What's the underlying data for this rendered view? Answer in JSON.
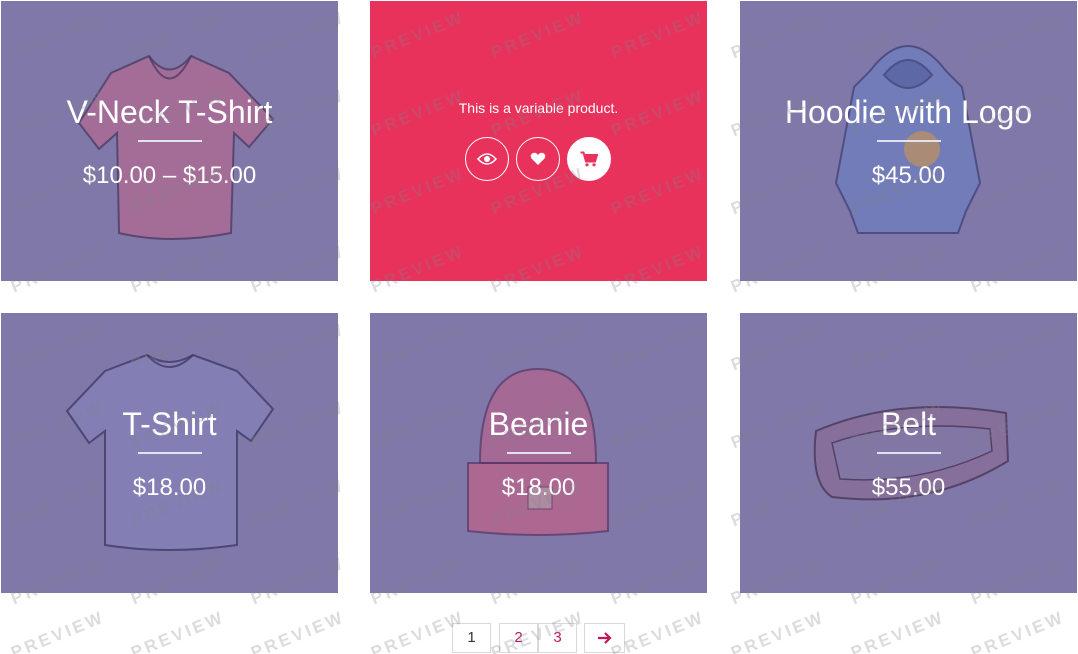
{
  "products": [
    {
      "title": "V-Neck T-Shirt",
      "price": "$10.00 – $15.00"
    },
    {
      "description": "This is a variable product."
    },
    {
      "title": "Hoodie with Logo",
      "price": "$45.00"
    },
    {
      "title": "T-Shirt",
      "price": "$18.00"
    },
    {
      "title": "Beanie",
      "price": "$18.00"
    },
    {
      "title": "Belt",
      "price": "$55.00"
    }
  ],
  "actions": {
    "quick_view_icon": "eye-icon",
    "wishlist_icon": "heart-icon",
    "cart_icon": "cart-icon"
  },
  "pagination": {
    "pages": [
      "1",
      "2",
      "3"
    ],
    "current": "1",
    "next_icon": "arrow-right-icon"
  },
  "watermark": "PREVIEW",
  "colors": {
    "card_overlay": "#8078a8",
    "hover_card": "#e8325c",
    "link": "#c2185b",
    "divider": "#dfe4f2"
  }
}
